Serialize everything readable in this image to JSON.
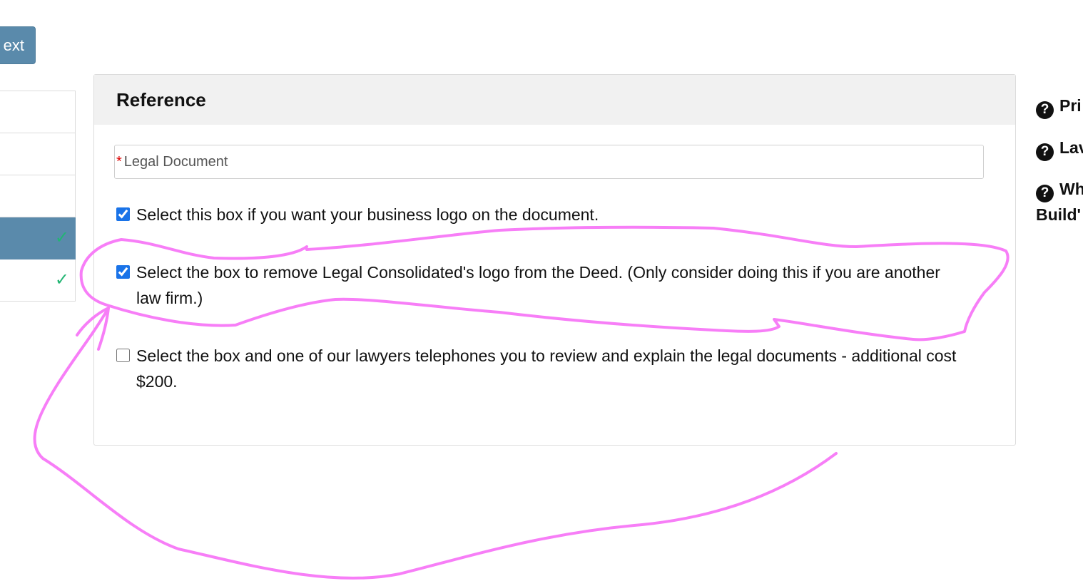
{
  "toolbar": {
    "next_label": "ext"
  },
  "steps": [
    {
      "state": "default",
      "check": ""
    },
    {
      "state": "default",
      "check": ""
    },
    {
      "state": "default",
      "check": ""
    },
    {
      "state": "active",
      "check": "✓"
    },
    {
      "state": "complete",
      "check": "✓"
    }
  ],
  "panel": {
    "title": "Reference",
    "field": {
      "required_mark": "*",
      "label": "Legal Document"
    },
    "options": [
      {
        "checked": true,
        "text": "Select this box if you want your business logo on the document."
      },
      {
        "checked": true,
        "text": "Select the box to remove Legal Consolidated's logo from the Deed. (Only consider doing this if you are another law firm.)"
      },
      {
        "checked": false,
        "text": "Select the box and one of our lawyers telephones you to review and explain the legal documents - additional cost $200."
      }
    ]
  },
  "help_links": [
    {
      "icon": "question-circle-icon",
      "text": "Pri"
    },
    {
      "icon": "question-circle-icon",
      "text": "Lav"
    },
    {
      "icon": "question-circle-icon",
      "text": "Wh",
      "text2": "Build'"
    }
  ],
  "annotation": {
    "color": "#f77ef7"
  }
}
